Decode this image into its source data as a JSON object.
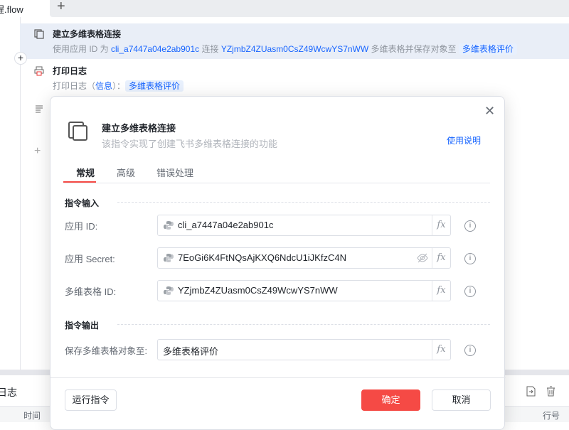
{
  "tabs": {
    "current": "程.flow",
    "add": "+"
  },
  "steps": [
    {
      "title": "建立多维表格连接",
      "sub_prefix": "使用应用 ID 为",
      "app_id": "cli_a7447a04e2ab901c",
      "sub_mid": "连接",
      "table_id": "YZjmbZ4ZUasm0CsZ49WcwYS7nWW",
      "sub_suffix": "多维表格并保存对象至",
      "var": "多维表格评价"
    },
    {
      "title": "打印日志",
      "sub_prefix": "打印日志（",
      "level": "信息",
      "sub_suffix": "）：",
      "var": "多维表格评价"
    }
  ],
  "bottom": {
    "log_title": "日志",
    "col_time": "时间",
    "col_line": "行号"
  },
  "modal": {
    "title": "建立多维表格连接",
    "desc": "该指令实现了创建飞书多维表格连接的功能",
    "help": "使用说明",
    "tabs": [
      "常规",
      "高级",
      "错误处理"
    ],
    "input_section": "指令输入",
    "output_section": "指令输出",
    "fields": [
      {
        "label": "应用 ID:",
        "value": "cli_a7447a04e2ab901c"
      },
      {
        "label": "应用 Secret:",
        "value": "7EoGi6K4FtNQsAjKXQ6NdcU1iJKfzC4N"
      },
      {
        "label": "多维表格 ID:",
        "value": "YZjmbZ4ZUasm0CsZ49WcwYS7nWW"
      }
    ],
    "output": {
      "label": "保存多维表格对象至:",
      "value": "多维表格评价"
    },
    "fx": "fx",
    "info": "i",
    "run": "运行指令",
    "ok": "确定",
    "cancel": "取消"
  },
  "colors": {
    "accent": "#1664ff",
    "primary": "#f54a45"
  }
}
